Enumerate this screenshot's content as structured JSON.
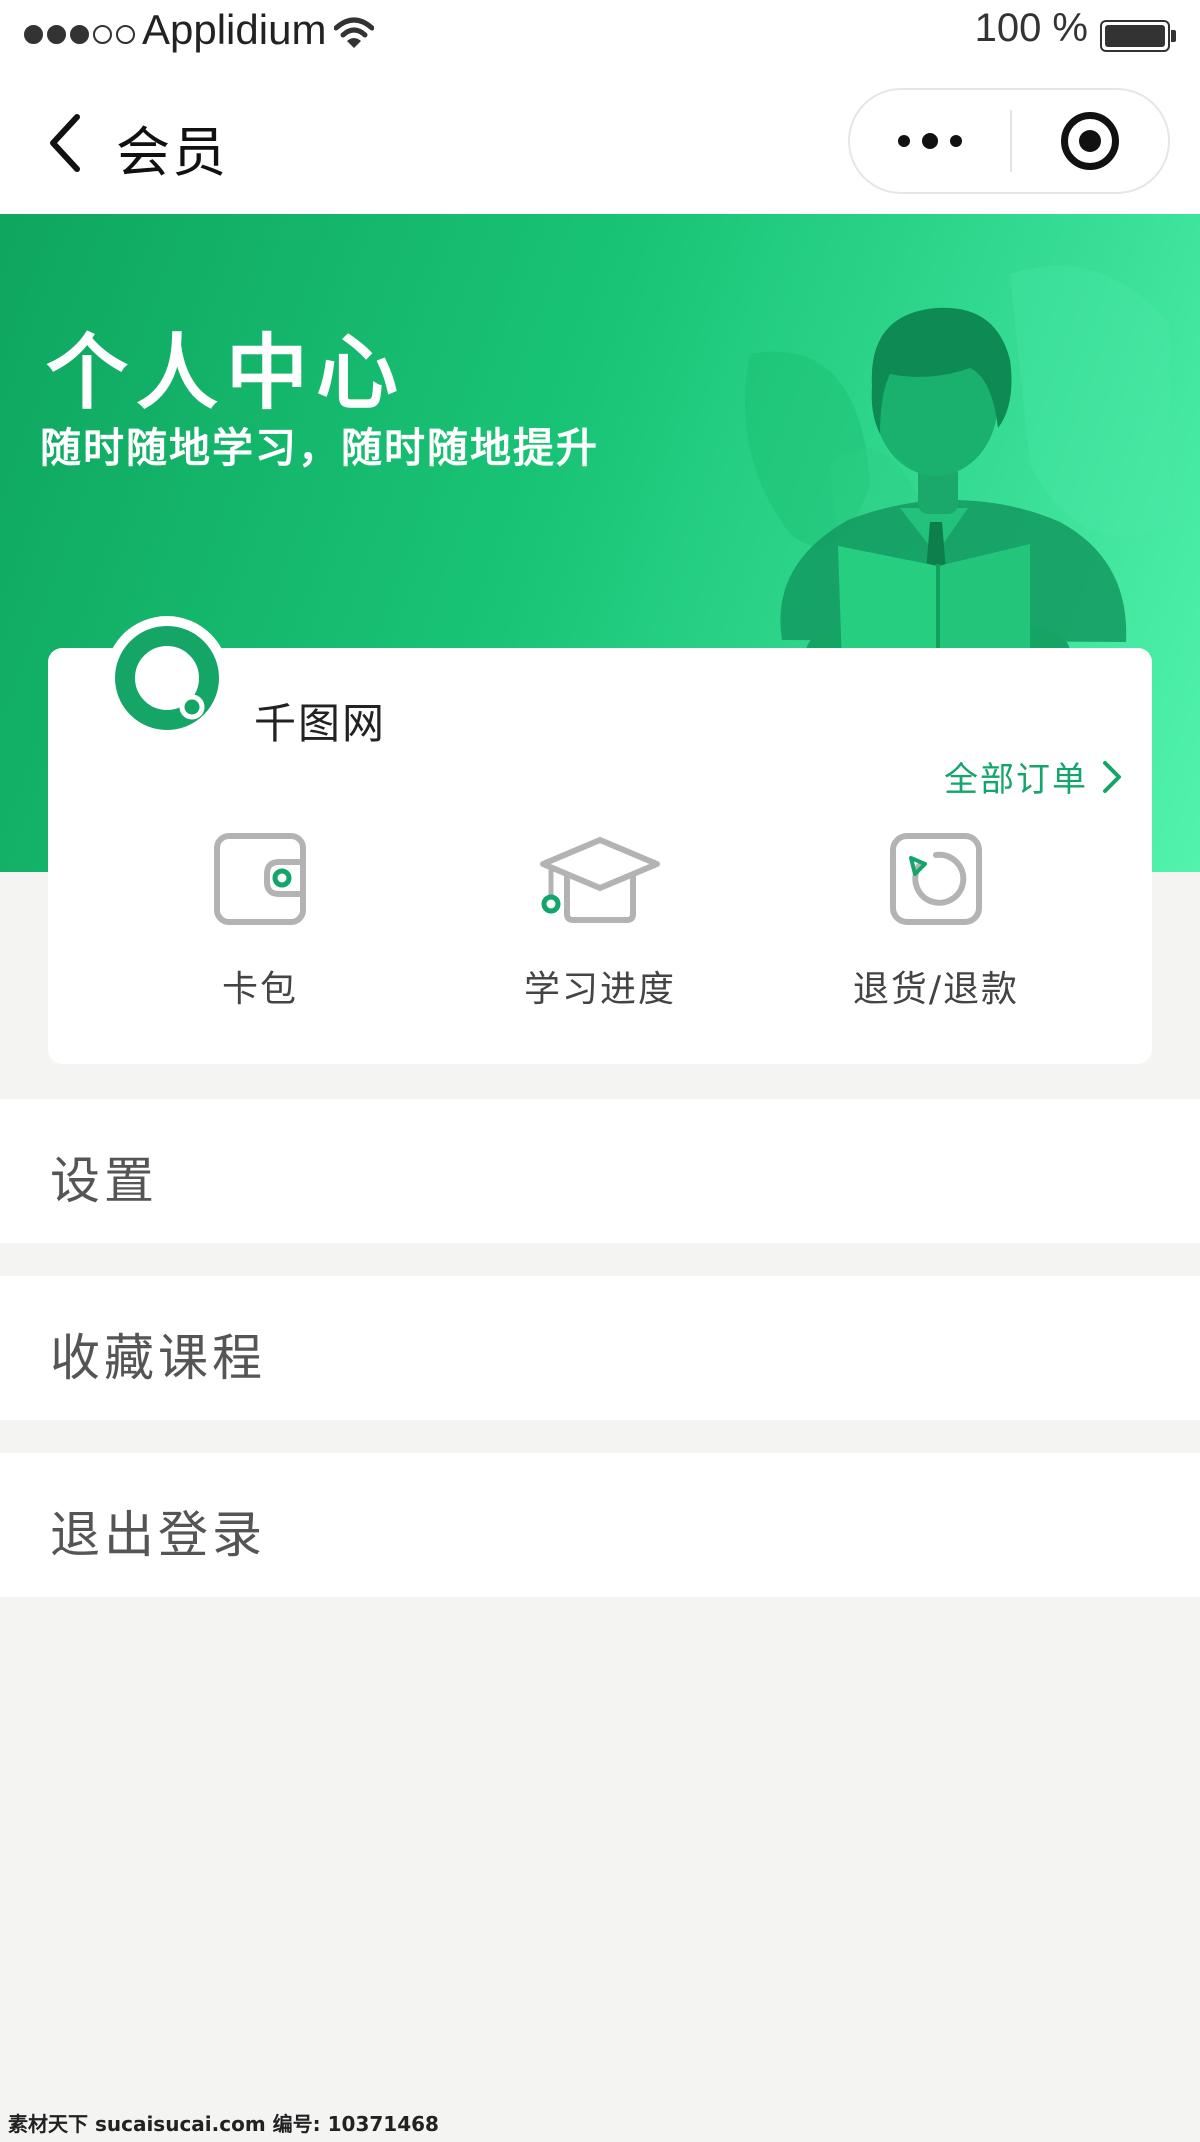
{
  "status_bar": {
    "carrier": "Applidium",
    "battery": "100 %",
    "signal_bars_filled": 3,
    "signal_bars_total": 5
  },
  "nav": {
    "title": "会员",
    "back_icon": "chevron-left-icon",
    "more_icon": "more-dots-icon",
    "close_icon": "target-ring-icon"
  },
  "hero": {
    "title": "个人中心",
    "subtitle": "随时随地学习，随时随地提升",
    "illustration": "person-reading-book",
    "gradient_colors": [
      "#0fa65f",
      "#52f4ad"
    ]
  },
  "profile": {
    "username": "千图网",
    "all_orders_label": "全部订单",
    "quick_actions": [
      {
        "label": "卡包",
        "icon": "wallet-icon"
      },
      {
        "label": "学习进度",
        "icon": "graduation-cap-icon"
      },
      {
        "label": "退货/退款",
        "icon": "refund-icon"
      }
    ]
  },
  "menu": [
    {
      "label": "设置"
    },
    {
      "label": "收藏课程"
    },
    {
      "label": "退出登录"
    }
  ],
  "watermark": "素材天下 sucaisucai.com  编号: 10371468",
  "colors": {
    "accent": "#13a56a",
    "background": "#f4f4f3",
    "card": "#ffffff",
    "icon_gray": "#b3b3b3"
  }
}
